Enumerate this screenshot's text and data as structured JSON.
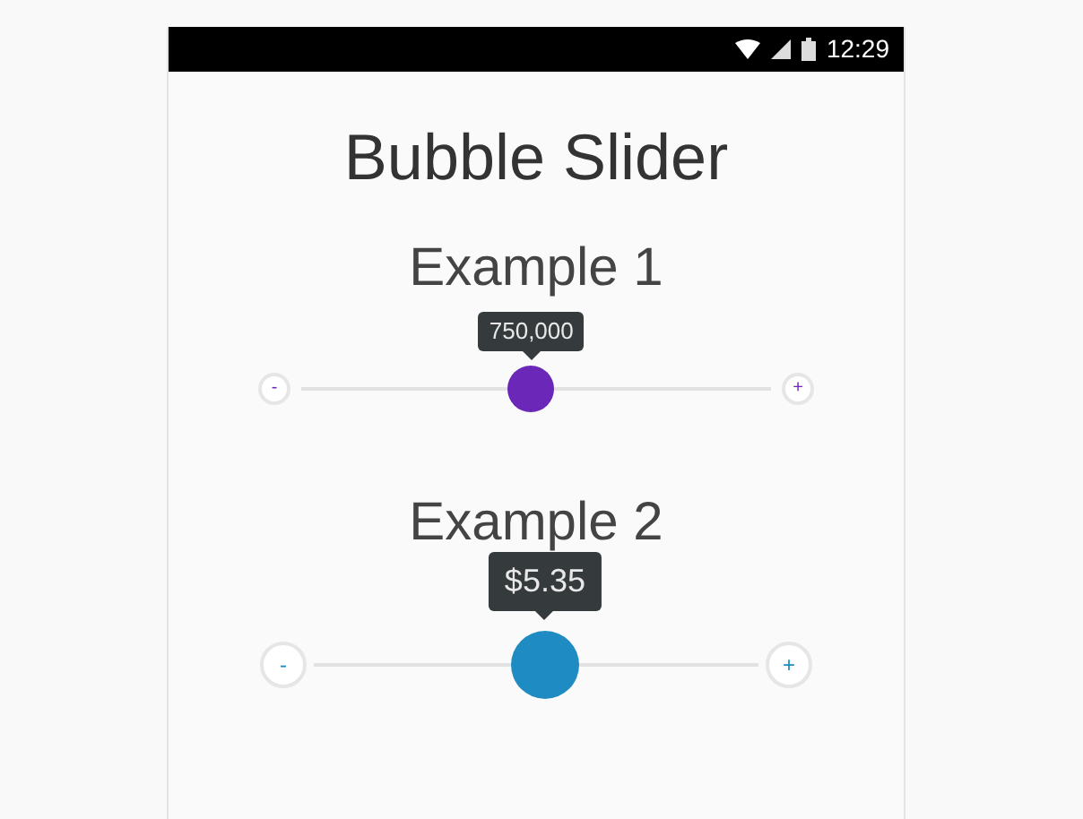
{
  "status_bar": {
    "time": "12:29"
  },
  "title": "Bubble Slider",
  "examples": [
    {
      "heading": "Example 1",
      "value": "750,000",
      "level": 0.49,
      "color": "#6a27b8",
      "kind": "small",
      "minus": "-",
      "plus": "+"
    },
    {
      "heading": "Example 2",
      "value": "$5.35",
      "level": 0.52,
      "color": "#1e8bc3",
      "kind": "large",
      "minus": "-",
      "plus": "+"
    }
  ]
}
